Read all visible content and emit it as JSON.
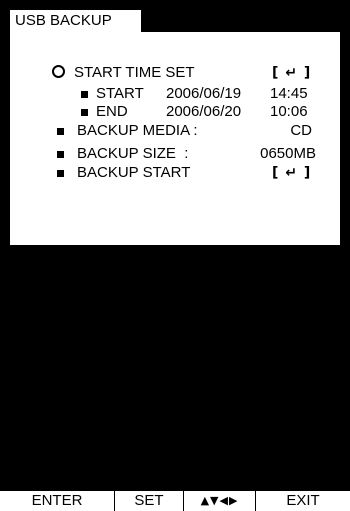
{
  "title": "USB BACKUP",
  "menu": {
    "start_time_set": {
      "label": "START TIME SET",
      "enter_symbol": "[ ↵ ]"
    },
    "start": {
      "label": "START",
      "date": "2006/06/19",
      "time": "14:45"
    },
    "end": {
      "label": "END",
      "date": "2006/06/20",
      "time": "10:06"
    },
    "backup_media": {
      "label": "BACKUP MEDIA :",
      "value": "CD"
    },
    "backup_size": {
      "label": "BACKUP SIZE  :",
      "value": "0650MB"
    },
    "backup_start": {
      "label": "BACKUP START",
      "enter_symbol": "[ ↵ ]"
    }
  },
  "footer": {
    "enter": "ENTER",
    "set": "SET",
    "arrows": "▲▼◀▶",
    "exit": "EXIT"
  },
  "colors": {
    "background": "#000000",
    "panel": "#ffffff",
    "text": "#000000"
  }
}
